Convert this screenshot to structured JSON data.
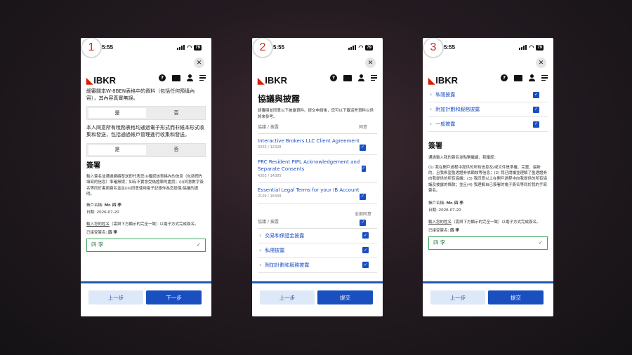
{
  "phones": [
    {
      "badge": "1",
      "time": "5:55",
      "battery": "79",
      "buttons": {
        "back": "上一步",
        "next": "下一步"
      }
    },
    {
      "badge": "2",
      "time": "5:55",
      "battery": "79",
      "buttons": {
        "back": "上一步",
        "next": "提交"
      }
    },
    {
      "badge": "3",
      "time": "5:55",
      "battery": "79",
      "buttons": {
        "back": "上一步",
        "next": "提交"
      }
    }
  ],
  "header": {
    "logo": "IBKR",
    "close_glyph": "✕"
  },
  "p1": {
    "intro": "細審閱本W-8BEN表格中的資料（包括任何預填內容），其內容真實無誤。",
    "yes": "是",
    "no": "否",
    "consent": "本人同意所有稅務表格均通過電子形式而非紙本形式收集和發送，包括通過帳戶管理進行收集和發送。",
    "sign_title": "簽署",
    "sign_desc": "輸入簽名並通過網絡發送即代表您(i)確認該表格內的信息（包括預先填寫的信息）準確無誤；如有不實會受偽證罪的處罰；(ii)同意數字簽名等同於書面簽名並且(iii)同意使用電子記錄作為您提價/協議的證明。",
    "account_label": "帳戶名稱:",
    "account_value": "Mr. 四 李",
    "date_label": "日期:",
    "date_value": "2026-07-20",
    "enter_name_u": "輸入您的姓名",
    "enter_name_rest": "（需與下方顯示的完全一致）以電子方式完成簽名。",
    "accepted_label": "已接受簽名:",
    "accepted_value": "四 李",
    "name_value": "四 李"
  },
  "p2": {
    "title": "協議與披露",
    "desc": "請審閱並同意以下披露資料。提交申請後，您可以下載這些資料以供將來參考。",
    "col1": "協議 / 披露",
    "col2": "同意",
    "docs": [
      {
        "title": "Interactive Brokers LLC Client Agreement",
        "code": "3203 / 12328"
      },
      {
        "title": "PRC Resident PIPL Acknowledgement and Separate Consents",
        "code": "4303 / 14385"
      },
      {
        "title": "Essential Legal Terms for your IB Account",
        "code": "2109 / 16449"
      }
    ],
    "col1b": "協議 / 披露",
    "all_agree": "全部同意",
    "groups": [
      "交易和保證金披露",
      "私隱披露",
      "附加計劃和服務披露"
    ]
  },
  "p3": {
    "groups": [
      "私隱披露",
      "附加計劃和服務披露",
      "一般披露"
    ],
    "sign_title": "簽署",
    "sign_intro": "通過輸入我的簽名並點擊繼續，我確認：",
    "sign_desc": "(1) 我在開戶過程中提供的所有信息及/或文件是準確、完整、最新的，且我希望盈透證券依賴該等信息；(2) 我已閱讀並理解了盈透證券向我提供的所有協議；(3) 我同意以上在開戶過程中向我提供的所有協議及披露的條款；並且(4) 我理解自己簽署的電子簽名等同於我的手寫簽名。",
    "account_label": "帳戶名稱:",
    "account_value": "Mr. 四 李",
    "date_label": "日期:",
    "date_value": "2026-07-20",
    "enter_name_u": "輸入您的姓名",
    "enter_name_rest": "（需與下方顯示的完全一致）以電子方式完成簽名。",
    "accepted_label": "已接受簽名:",
    "accepted_value": "四 李",
    "name_value": "四 李"
  }
}
